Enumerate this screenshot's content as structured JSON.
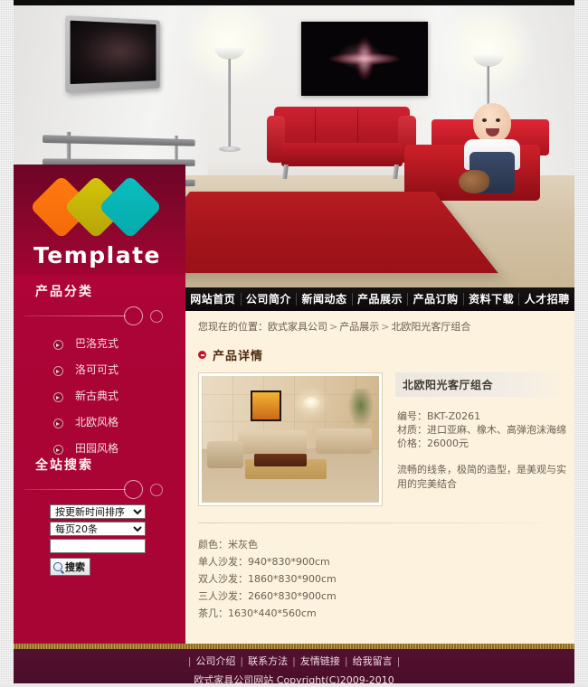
{
  "site": {
    "logo_word": "Template"
  },
  "sidebar": {
    "categories_title": "产品分类",
    "categories": [
      {
        "label": "巴洛克式"
      },
      {
        "label": "洛可可式"
      },
      {
        "label": "新古典式"
      },
      {
        "label": "北欧风格"
      },
      {
        "label": "田园风格"
      }
    ],
    "search_title": "全站搜索",
    "sort_select": "按更新时间排序",
    "perpage_select": "每页20条",
    "keyword_value": "",
    "search_button": "搜索"
  },
  "nav": {
    "items": [
      {
        "label": "网站首页"
      },
      {
        "label": "公司简介"
      },
      {
        "label": "新闻动态"
      },
      {
        "label": "产品展示"
      },
      {
        "label": "产品订购"
      },
      {
        "label": "资料下载"
      },
      {
        "label": "人才招聘"
      }
    ]
  },
  "breadcrumb": {
    "prefix": "您现在的位置：",
    "items": [
      "欧式家具公司",
      "产品展示",
      "北欧阳光客厅组合"
    ],
    "separator": ">"
  },
  "panel": {
    "title": "产品详情"
  },
  "product": {
    "name": "北欧阳光客厅组合",
    "code_line": "编号：BKT-Z0261",
    "material_line": "材质：进口亚麻、橡木、高弹泡沫海绵",
    "price_line": "价格：26000元",
    "description": "流畅的线条，极简的造型，是美观与实用的完美结合",
    "specs": [
      "颜色：米灰色",
      "单人沙发：940*830*900cm",
      "双人沙发：1860*830*900cm",
      "三人沙发：2660*830*900cm",
      "茶几：1630*440*560cm"
    ]
  },
  "footer": {
    "links": [
      "公司介绍",
      "联系方法",
      "友情链接",
      "给我留言"
    ],
    "copyright": "欧式家具公司网站 Copyright(C)2009-2010"
  },
  "colors": {
    "sidebar_red": "#a80434",
    "nav_black": "#0a0808",
    "content_cream": "#fdf2dd",
    "footer_maroon": "#4a0e2a",
    "accent_gold": "#b08b3c"
  }
}
